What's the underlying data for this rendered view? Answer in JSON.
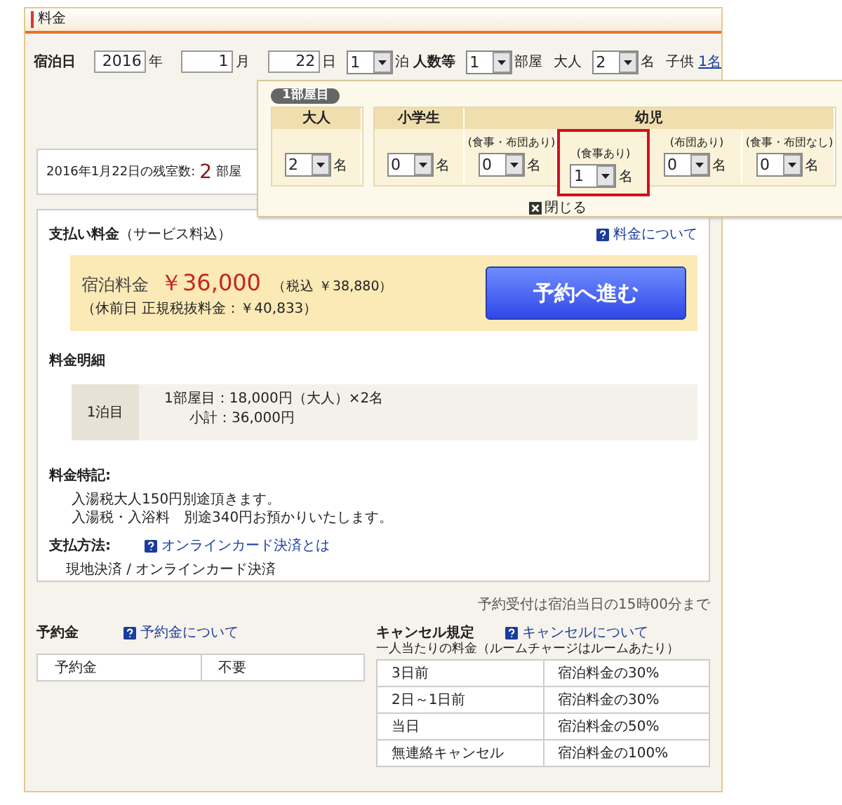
{
  "section": {
    "title": "料金"
  },
  "search_form": [
    {
      "kind": "label",
      "text": "宿泊日"
    },
    {
      "kind": "input",
      "value": "2016",
      "unit": "年"
    },
    {
      "kind": "input",
      "value": "1",
      "unit": "月"
    },
    {
      "kind": "input",
      "value": "22",
      "unit": "日"
    },
    {
      "kind": "select",
      "value": "1",
      "unit": "泊"
    },
    {
      "kind": "label",
      "text": "人数等"
    },
    {
      "kind": "select",
      "value": "1",
      "unit": "部屋"
    },
    {
      "kind": "text",
      "text": "大人"
    },
    {
      "kind": "select",
      "value": "2",
      "unit": "名"
    },
    {
      "kind": "text",
      "text": "子供"
    },
    {
      "kind": "link",
      "text": "1名"
    }
  ],
  "remaining": {
    "label": "2016年1月22日の残室数:",
    "count": "2",
    "unit": "部屋"
  },
  "popup": {
    "badge": "1部屋目",
    "close": "閉じる",
    "tables": [
      {
        "groups": [
          {
            "label": "大人",
            "columns": [
              {
                "value": "2",
                "unit": "名",
                "selected": false
              }
            ]
          }
        ]
      },
      {
        "groups": [
          {
            "label": "小学生",
            "columns": [
              {
                "value": "0",
                "unit": "名",
                "selected": false
              }
            ]
          },
          {
            "label": "幼児",
            "columns": [
              {
                "sublabel": "(食事・布団あり)",
                "value": "0",
                "unit": "名",
                "selected": false
              },
              {
                "sublabel": "(食事あり)",
                "value": "1",
                "unit": "名",
                "selected": true
              },
              {
                "sublabel": "(布団あり)",
                "value": "0",
                "unit": "名",
                "selected": false
              },
              {
                "sublabel": "(食事・布団なし)",
                "value": "0",
                "unit": "名",
                "selected": false
              }
            ]
          }
        ]
      }
    ]
  },
  "payment": {
    "title": "**支払い料金**（サービス料込）",
    "help_link": "料金について",
    "price_label": "宿泊料金",
    "price": "￥36,000",
    "tax": "（税込 ￥38,880）",
    "note": "（休前日 正規税抜料金：￥40,833）",
    "button": "予約へ進む",
    "breakdown_title": "料金明細",
    "breakdown": [
      {
        "night": "1泊目",
        "lines": [
          "1部屋目：18,000円（大人）×2名",
          "小計：36,000円"
        ]
      }
    ],
    "notes_title": "料金特記:",
    "notes": [
      "入湯税大人150円別途頂きます。",
      "入湯税・入浴料　別途340円お預かりいたします。"
    ],
    "method_title": "支払方法:",
    "method_link": "オンラインカード決済とは",
    "method": "現地決済 / オンラインカード決済"
  },
  "deadline": "予約受付は宿泊当日の15時00分まで",
  "deposit": {
    "title": "予約金",
    "link": "予約金について",
    "rows": [
      [
        "予約金",
        "不要"
      ]
    ]
  },
  "cancel": {
    "title": "キャンセル規定",
    "link": "キャンセルについて",
    "subtitle": "一人当たりの料金（ルームチャージはルームあたり）",
    "rows": [
      [
        "3日前",
        "宿泊料金の30%"
      ],
      [
        "2日～1日前",
        "宿泊料金の30%"
      ],
      [
        "当日",
        "宿泊料金の50%"
      ],
      [
        "無連絡キャンセル",
        "宿泊料金の100%"
      ]
    ]
  }
}
